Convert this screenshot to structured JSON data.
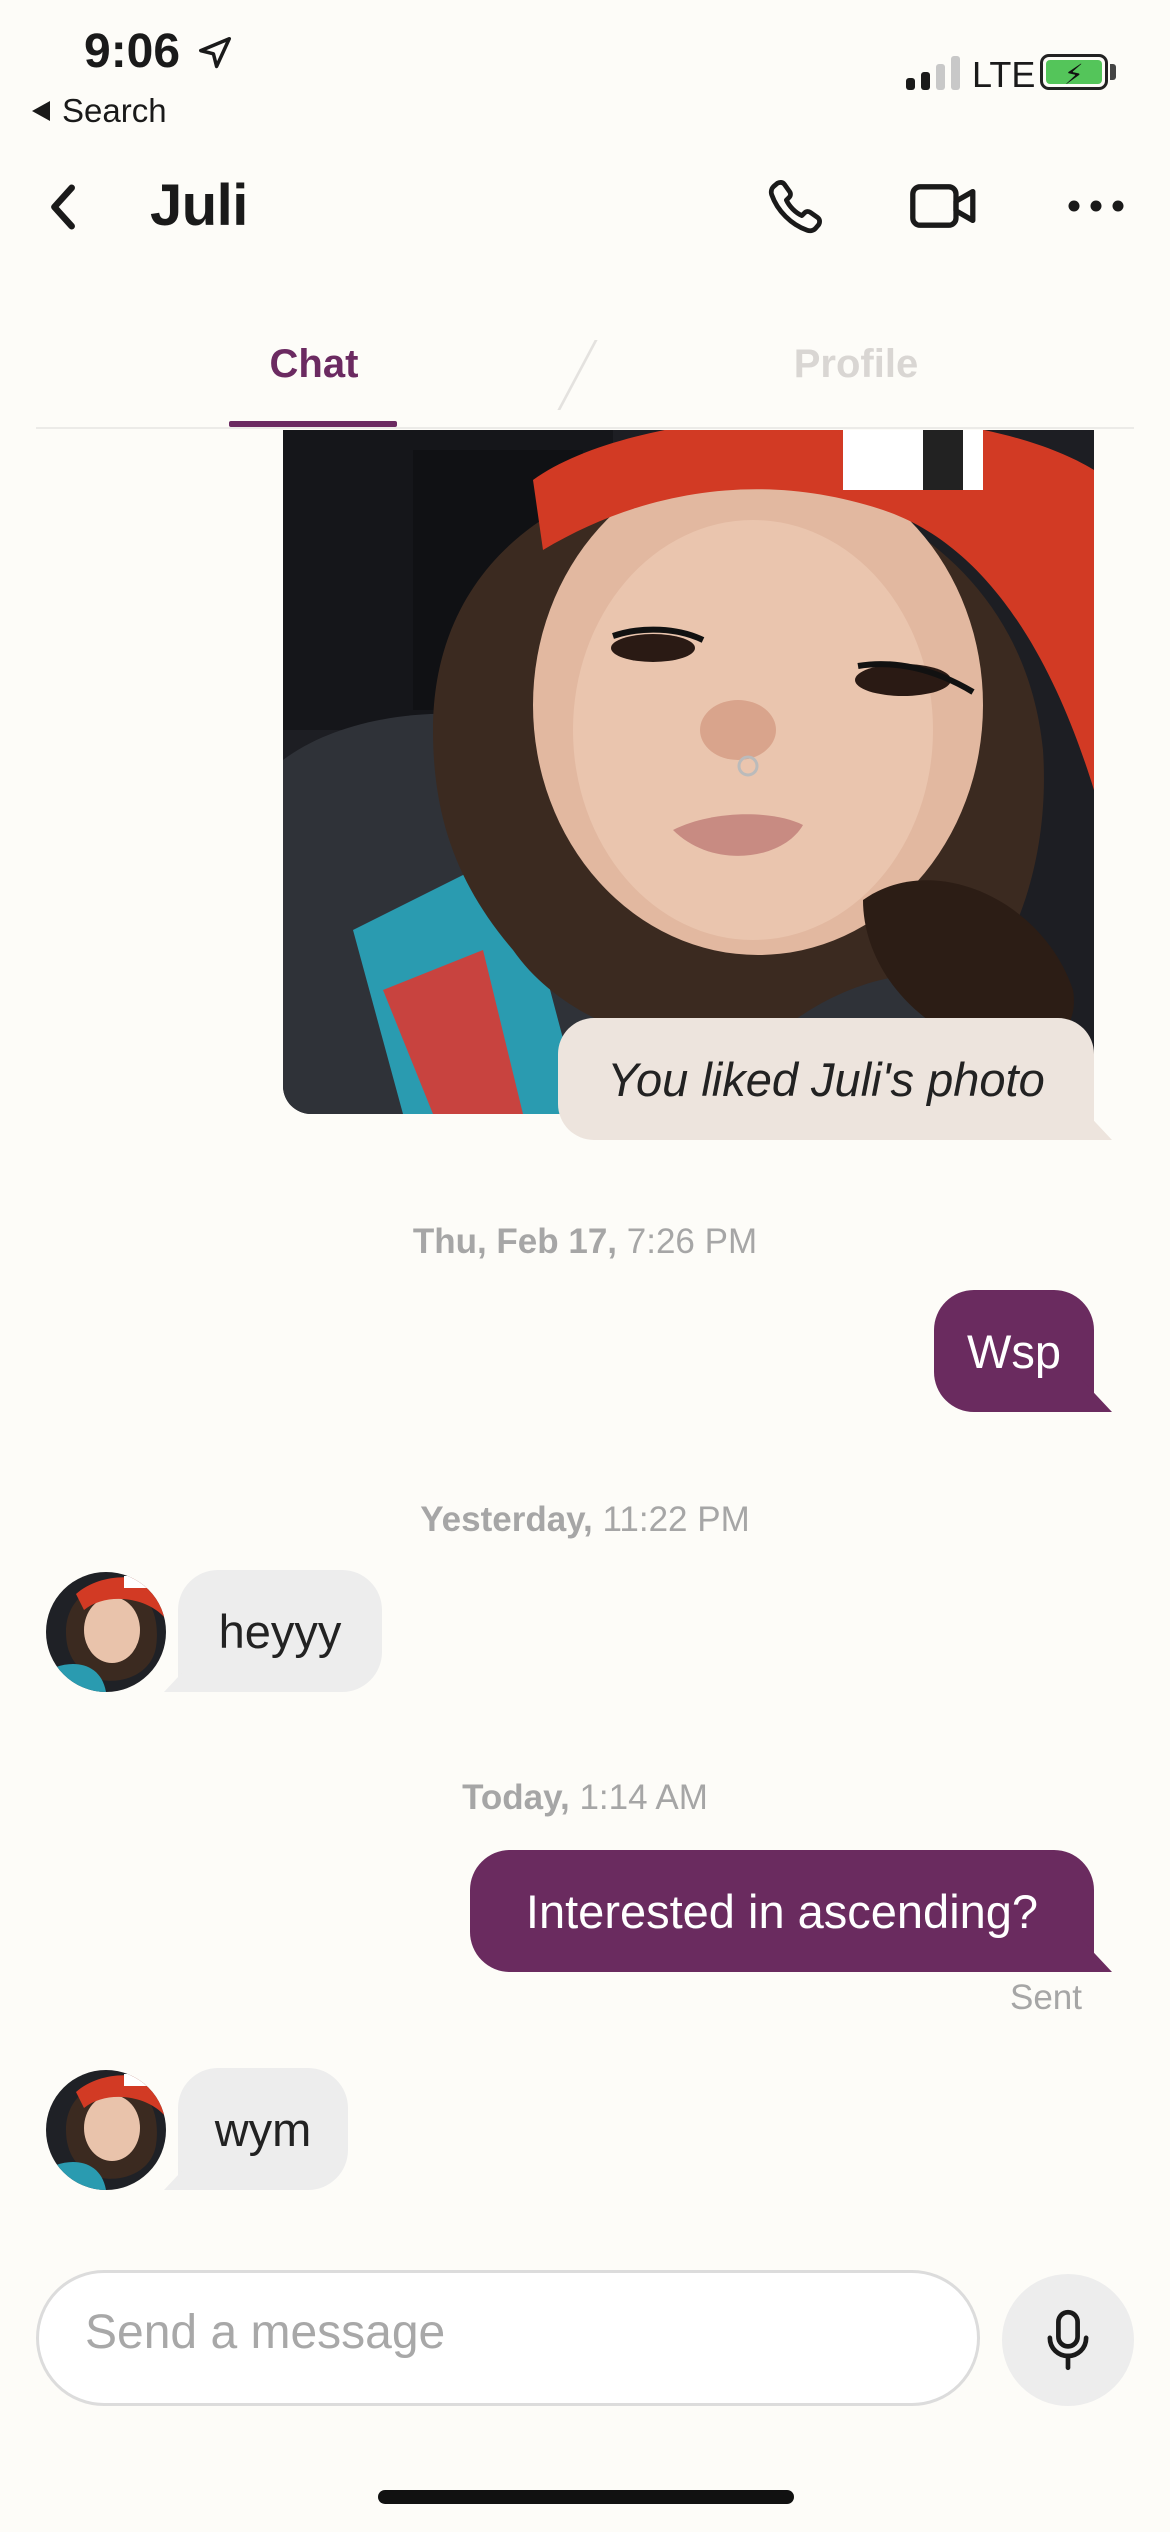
{
  "status_bar": {
    "time": "9:06",
    "back_app": "Search",
    "network": "LTE"
  },
  "header": {
    "title": "Juli"
  },
  "tabs": [
    {
      "label": "Chat",
      "active": true
    },
    {
      "label": "Profile",
      "active": false
    }
  ],
  "messages": {
    "liked_photo_caption": "You liked Juli's photo",
    "stamp1": {
      "day": "Thu, Feb 17,",
      "time": "7:26 PM"
    },
    "msg1": "Wsp",
    "stamp2": {
      "day": "Yesterday,",
      "time": "11:22 PM"
    },
    "msg2": "heyyy",
    "stamp3": {
      "day": "Today,",
      "time": "1:14 AM"
    },
    "msg3": "Interested in ascending?",
    "msg3_status": "Sent",
    "msg4": "wym"
  },
  "composer": {
    "placeholder": "Send a message"
  },
  "colors": {
    "accent": "#6a2b5f",
    "background": "#fdfcf8",
    "liked_bubble": "#ede4dd",
    "incoming_bubble": "#ededed"
  },
  "icons": [
    "location-arrow-icon",
    "signal-icon",
    "battery-icon",
    "back-chevron-icon",
    "phone-icon",
    "video-camera-icon",
    "more-icon",
    "microphone-icon"
  ]
}
